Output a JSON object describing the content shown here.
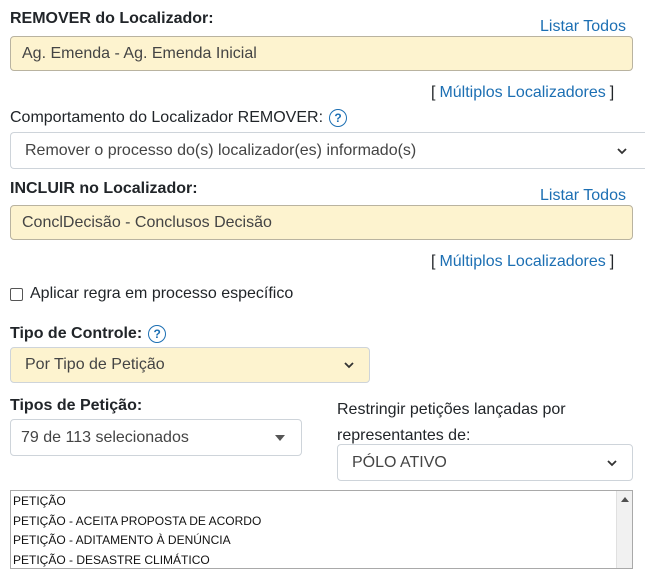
{
  "remover": {
    "label": "REMOVER do Localizador:",
    "listar_todos": "Listar Todos",
    "value": "Ag. Emenda - Ag. Emenda Inicial",
    "multiplos": "Múltiplos Localizadores"
  },
  "comportamento": {
    "label": "Comportamento do Localizador REMOVER:",
    "help": "?",
    "selected": "Remover o processo do(s) localizador(es) informado(s)"
  },
  "incluir": {
    "label": "INCLUIR no Localizador:",
    "listar_todos": "Listar Todos",
    "value": "ConclDecisão - Conclusos Decisão",
    "multiplos": "Múltiplos Localizadores"
  },
  "aplicar_regra": {
    "label": "Aplicar regra em processo específico",
    "checked": false
  },
  "tipo_controle": {
    "label": "Tipo de Controle:",
    "help": "?",
    "selected": "Por Tipo de Petição"
  },
  "tipos_peticao": {
    "label": "Tipos de Petição:",
    "selected_summary": "79 de 113 selecionados"
  },
  "restringir": {
    "label_line1": "Restringir petições lançadas por",
    "label_line2": "representantes de:",
    "selected": "PÓLO ATIVO"
  },
  "peticoes_list": [
    "PETIÇÃO",
    "PETIÇÃO - ACEITA PROPOSTA DE ACORDO",
    "PETIÇÃO - ADITAMENTO À DENÚNCIA",
    "PETIÇÃO - DESASTRE CLIMÁTICO"
  ],
  "brackets": {
    "open": "[",
    "close": "]"
  },
  "colors": {
    "link": "#1c6fb3",
    "field_yellow": "#fdf3cf"
  }
}
